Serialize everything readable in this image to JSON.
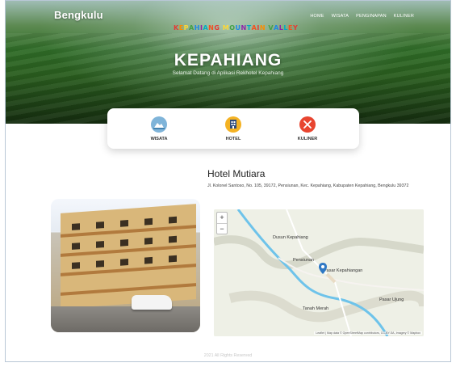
{
  "header": {
    "brand": "Bengkulu",
    "nav": [
      "HOME",
      "WISATA",
      "PENGINAPAN",
      "KULINER"
    ],
    "sign": [
      "K",
      "E",
      "P",
      "A",
      "H",
      "I",
      "A",
      "N",
      "G",
      " ",
      "M",
      "O",
      "U",
      "N",
      "T",
      "A",
      "I",
      "N",
      " ",
      "V",
      "A",
      "L",
      "L",
      "E",
      "Y"
    ],
    "title": "KEPAHIANG",
    "subtitle": "Selamat Datang di Aplikasi Rekhotel Kepahiang"
  },
  "categories": [
    {
      "label": "WISATA",
      "icon": "mountain-icon",
      "color": "#7fb4d9"
    },
    {
      "label": "HOTEL",
      "icon": "hotel-icon",
      "color": "#f4b223"
    },
    {
      "label": "KULINER",
      "icon": "utensils-icon",
      "color": "#e84530"
    }
  ],
  "hotel": {
    "name": "Hotel Mutiara",
    "address": "Jl. Kolonel Santoso, No. 105, 39172, Pensiunan, Kec. Kepahiang, Kabupaten Kepahiang, Bengkulu 39372"
  },
  "map": {
    "zoom_in": "+",
    "zoom_out": "−",
    "labels": [
      "Dusun Kepahiang",
      "Pensiunan",
      "Pasar Kepahiangan",
      "Pasar Ujung",
      "Tanah Merah"
    ],
    "attribution": "Leaflet | Map data © OpenStreetMap contributors, CC-BY-SA, Imagery © Mapbox"
  },
  "footer": "2021 All Rights Reserved"
}
